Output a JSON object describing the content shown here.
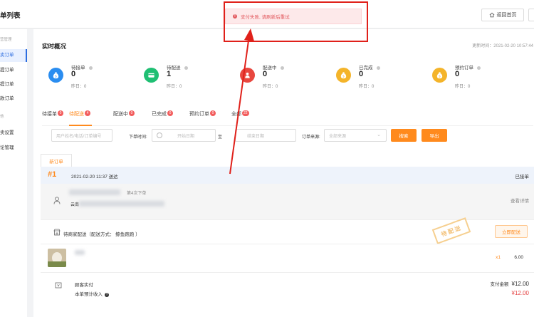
{
  "header": {
    "title": "单列表",
    "home_button": "返回首页"
  },
  "toast": {
    "message": "支付失败, 请刷新后重试",
    "color": "#e25a5f"
  },
  "sidebar": {
    "groups": [
      "营管理",
      "他"
    ],
    "items": [
      "卖订单",
      "提订单",
      "提订单",
      "款订单",
      "卖设置",
      "论管理"
    ]
  },
  "overview": {
    "title": "实时概况",
    "update_time": "更新时间：2021-02-20 10:57:44",
    "stats": [
      {
        "label": "待接单",
        "value": "0",
        "yesterday": "昨日：0",
        "color": "#2a8df0",
        "icon": "money-bag-icon"
      },
      {
        "label": "待配送",
        "value": "1",
        "yesterday": "昨日：0",
        "color": "#1fbf73",
        "icon": "card-icon"
      },
      {
        "label": "配送中",
        "value": "0",
        "yesterday": "昨日：0",
        "color": "#e8473f",
        "icon": "courier-icon"
      },
      {
        "label": "已完成",
        "value": "0",
        "yesterday": "昨日：0",
        "color": "#f4b42a",
        "icon": "money-bag-icon"
      },
      {
        "label": "预约订单",
        "value": "0",
        "yesterday": "昨日：0",
        "color": "#f4b42a",
        "icon": "money-bag-icon"
      }
    ]
  },
  "tabs": [
    {
      "label": "待接单",
      "badge": "0"
    },
    {
      "label": "待配送",
      "badge": "4"
    },
    {
      "label": "配送中",
      "badge": "0"
    },
    {
      "label": "已完成",
      "badge": "0"
    },
    {
      "label": "预约订单",
      "badge": "0"
    },
    {
      "label": "全部",
      "badge": "22"
    }
  ],
  "filters": {
    "search_placeholder": "用户姓名/电话/订单编号",
    "time_label": "下单时间:",
    "start_placeholder": "开始日期",
    "to_label": "至",
    "end_placeholder": "结束日期",
    "source_label": "订单来源:",
    "source_value": "全部来源",
    "search_button": "搜索",
    "export_button": "导出"
  },
  "order": {
    "tab_label": "新订单",
    "number": "#1",
    "time": "2021-02-20 11:37 送达",
    "status": "已接单",
    "customer_order_count": "第4次下单",
    "customer_address_prefix": "云南",
    "view_detail": "查看详情",
    "delivery_text": "待商家配送（配送方式：  鲸鱼跑跑 ）",
    "deliver_button": "立即配送",
    "stamp": "待配送",
    "product_qty": "x1",
    "product_price": "6.00",
    "summary_label": "顾客实付",
    "summary_total_label": "支付金额",
    "summary_total": "¥12.00",
    "income_label": "本单预计收入",
    "income_value": "¥12.00"
  }
}
